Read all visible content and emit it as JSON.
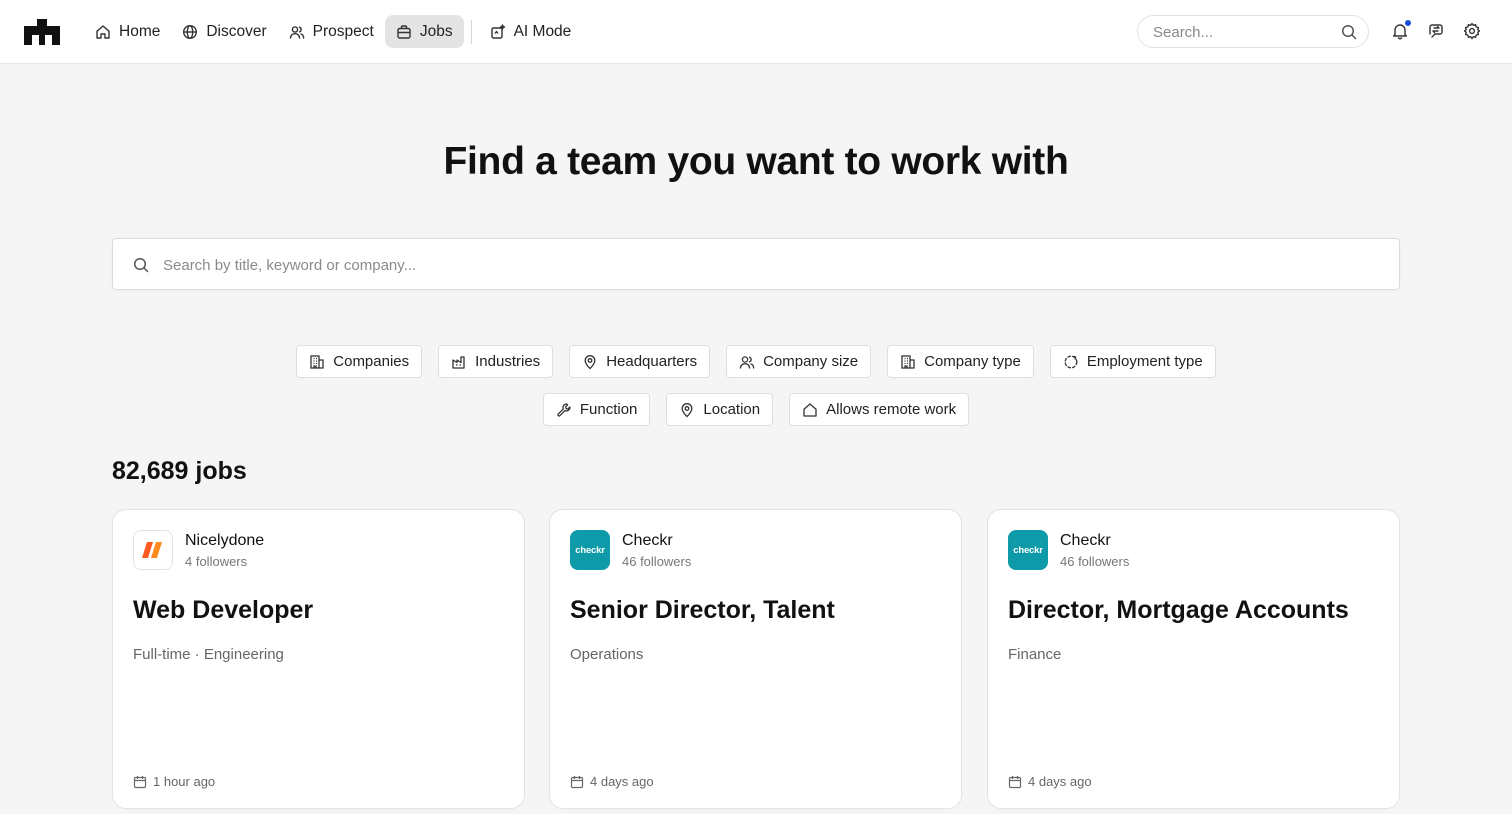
{
  "nav": {
    "items": [
      {
        "label": "Home",
        "icon": "home-icon"
      },
      {
        "label": "Discover",
        "icon": "globe-icon"
      },
      {
        "label": "Prospect",
        "icon": "users-icon"
      },
      {
        "label": "Jobs",
        "icon": "briefcase-icon",
        "active": true
      },
      {
        "label": "AI Mode",
        "icon": "ai-sparkle-icon"
      }
    ],
    "search_placeholder": "Search..."
  },
  "hero": {
    "title": "Find a team you want to work with",
    "search_placeholder": "Search by title, keyword or company..."
  },
  "filters": {
    "row1": [
      {
        "label": "Companies",
        "icon": "building-icon"
      },
      {
        "label": "Industries",
        "icon": "factory-icon"
      },
      {
        "label": "Headquarters",
        "icon": "map-pin-icon"
      },
      {
        "label": "Company size",
        "icon": "users-icon"
      },
      {
        "label": "Company type",
        "icon": "building-icon"
      },
      {
        "label": "Employment type",
        "icon": "dashed-cycle-icon"
      }
    ],
    "row2": [
      {
        "label": "Function",
        "icon": "wrench-icon"
      },
      {
        "label": "Location",
        "icon": "map-pin-icon"
      },
      {
        "label": "Allows remote work",
        "icon": "home-icon"
      }
    ]
  },
  "jobs": {
    "count_label": "82,689 jobs",
    "cards": [
      {
        "company": "Nicelydone",
        "followers": "4 followers",
        "title": "Web Developer",
        "meta": "Full-time · Engineering",
        "posted": "1 hour ago"
      },
      {
        "company": "Checkr",
        "logo_text": "checkr",
        "followers": "46 followers",
        "title": "Senior Director, Talent",
        "meta": "Operations",
        "posted": "4 days ago"
      },
      {
        "company": "Checkr",
        "logo_text": "checkr",
        "followers": "46 followers",
        "title": "Director, Mortgage Accounts",
        "meta": "Finance",
        "posted": "4 days ago"
      }
    ]
  },
  "colors": {
    "accent_dot": "#1d4ed8",
    "checkr_brand": "#0f9aa9",
    "nicelydone_brand": "#ff5a1f",
    "page_bg": "#f5f5f5"
  }
}
